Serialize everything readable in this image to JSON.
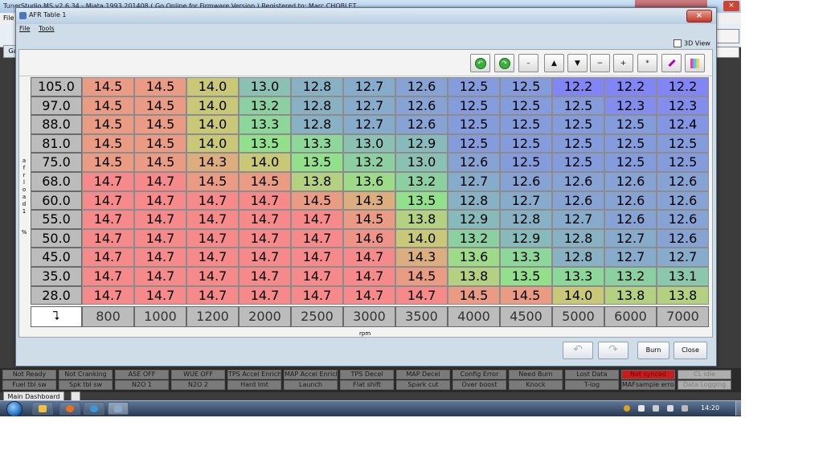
{
  "bg_window": {
    "title": "TunerStudio MS v2.6.34 - Miata 1993 201408 ( Go Online for Firmware Version ) Registered to: Marc CHOBLET",
    "menu": "File",
    "tab": "Ga",
    "close": "×"
  },
  "dialog": {
    "title": "AFR Table 1",
    "close": "×",
    "menu": [
      "File",
      "Tools"
    ],
    "view3d_label": "3D View",
    "y_axis_letters": "a\nf\nr\nl\no\na\nd\n1",
    "y_axis_unit": "%",
    "x_axis_label": "rpm",
    "corner_symbol": "⮧",
    "toolbar_buttons": [
      {
        "name": "undo-green-button",
        "glyph": "↶"
      },
      {
        "name": "redo-green-button",
        "glyph": "↷"
      },
      {
        "name": "decrement-button",
        "glyph": "–"
      },
      {
        "name": "increase-up-button",
        "glyph": "▲"
      },
      {
        "name": "decrease-down-button",
        "glyph": "▼"
      },
      {
        "name": "subtract-button",
        "glyph": "−"
      },
      {
        "name": "add-button",
        "glyph": "+"
      },
      {
        "name": "multiply-button",
        "glyph": "*"
      },
      {
        "name": "paint-brush-button",
        "glyph": ""
      },
      {
        "name": "color-palette-button",
        "glyph": ""
      }
    ],
    "buttons": {
      "undo": "↶",
      "redo": "↷",
      "burn": "Burn",
      "close": "Close"
    }
  },
  "table": {
    "y_values": [
      "105.0",
      "97.0",
      "88.0",
      "81.0",
      "75.0",
      "68.0",
      "60.0",
      "55.0",
      "50.0",
      "45.0",
      "35.0",
      "28.0"
    ],
    "x_values": [
      "800",
      "1000",
      "1200",
      "2000",
      "2500",
      "3000",
      "3500",
      "4000",
      "4500",
      "5000",
      "6000",
      "7000"
    ],
    "rows": [
      [
        "14.5",
        "14.5",
        "14.0",
        "13.0",
        "12.8",
        "12.7",
        "12.6",
        "12.5",
        "12.5",
        "12.2",
        "12.2",
        "12.2"
      ],
      [
        "14.5",
        "14.5",
        "14.0",
        "13.2",
        "12.8",
        "12.7",
        "12.6",
        "12.5",
        "12.5",
        "12.5",
        "12.3",
        "12.3"
      ],
      [
        "14.5",
        "14.5",
        "14.0",
        "13.3",
        "12.8",
        "12.7",
        "12.6",
        "12.5",
        "12.5",
        "12.5",
        "12.5",
        "12.4"
      ],
      [
        "14.5",
        "14.5",
        "14.0",
        "13.5",
        "13.3",
        "13.0",
        "12.9",
        "12.5",
        "12.5",
        "12.5",
        "12.5",
        "12.5"
      ],
      [
        "14.5",
        "14.5",
        "14.3",
        "14.0",
        "13.5",
        "13.2",
        "13.0",
        "12.6",
        "12.5",
        "12.5",
        "12.5",
        "12.5"
      ],
      [
        "14.7",
        "14.7",
        "14.5",
        "14.5",
        "13.8",
        "13.6",
        "13.2",
        "12.7",
        "12.6",
        "12.6",
        "12.6",
        "12.6"
      ],
      [
        "14.7",
        "14.7",
        "14.7",
        "14.7",
        "14.5",
        "14.3",
        "13.5",
        "12.8",
        "12.7",
        "12.6",
        "12.6",
        "12.6"
      ],
      [
        "14.7",
        "14.7",
        "14.7",
        "14.7",
        "14.7",
        "14.5",
        "13.8",
        "12.9",
        "12.8",
        "12.7",
        "12.6",
        "12.6"
      ],
      [
        "14.7",
        "14.7",
        "14.7",
        "14.7",
        "14.7",
        "14.6",
        "14.0",
        "13.2",
        "12.9",
        "12.8",
        "12.7",
        "12.6"
      ],
      [
        "14.7",
        "14.7",
        "14.7",
        "14.7",
        "14.7",
        "14.7",
        "14.3",
        "13.6",
        "13.3",
        "12.8",
        "12.7",
        "12.7"
      ],
      [
        "14.7",
        "14.7",
        "14.7",
        "14.7",
        "14.7",
        "14.7",
        "14.5",
        "13.8",
        "13.5",
        "13.3",
        "13.2",
        "13.1"
      ],
      [
        "14.7",
        "14.7",
        "14.7",
        "14.7",
        "14.7",
        "14.7",
        "14.7",
        "14.5",
        "14.5",
        "14.0",
        "13.8",
        "13.8"
      ]
    ]
  },
  "indicators_row1": [
    "Not Ready",
    "Not Cranking",
    "ASE OFF",
    "WUE OFF",
    "TPS Accel Enrich",
    "MAP Accel Enrich",
    "TPS Decel",
    "MAP Decel",
    "Config Error",
    "Need Burn",
    "Lost Data",
    "Not synced",
    "CL idle"
  ],
  "indicators_row2": [
    "Fuel tbl sw",
    "Spk tbl sw",
    "N2O 1",
    "N2O 2",
    "Hard lmt",
    "Launch",
    "Flat shift",
    "Spark cut",
    "Over boost",
    "Knock",
    "T-log",
    "MAFsample error",
    "Data Logging"
  ],
  "dashboard_tab": "Main Dashboard",
  "clock": "14:20",
  "colors": {
    "rich_blue": "#7f86f0",
    "lean_red": "#f58a8a",
    "mid_green": "#8ee28e",
    "dialog_frame": "#cfdde9"
  }
}
